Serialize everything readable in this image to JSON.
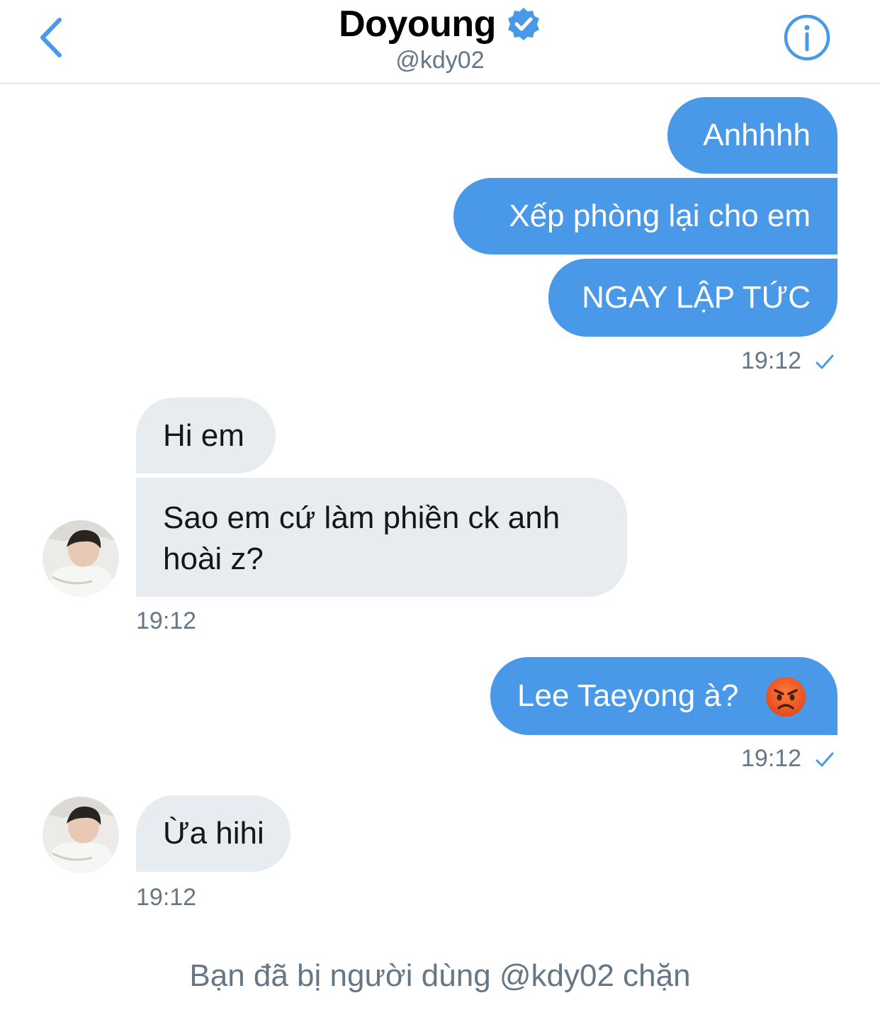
{
  "header": {
    "title": "Doyoung",
    "handle": "@kdy02",
    "verified_color": "#4a99e9",
    "back_icon": "chevron-left-icon",
    "info_icon": "info-icon"
  },
  "messages": [
    {
      "id": "m1",
      "from": "me",
      "text": "Anhhhh"
    },
    {
      "id": "m2",
      "from": "me",
      "text": "Xếp phòng lại cho em"
    },
    {
      "id": "m3",
      "from": "me",
      "text": "NGAY LẬP TỨC"
    },
    {
      "id": "m4",
      "from": "them",
      "text": "Hi em"
    },
    {
      "id": "m5",
      "from": "them",
      "text_line1": "Sao em cứ làm phiền ck anh",
      "text_line2": "hoài z?"
    },
    {
      "id": "m6",
      "from": "me",
      "text": "Lee Taeyong à?",
      "emoji": "😡"
    },
    {
      "id": "m7",
      "from": "them",
      "text": "Ừa hihi"
    }
  ],
  "timestamps": {
    "t1": "19:12",
    "t2": "19:12",
    "t3": "19:12",
    "t4": "19:12"
  },
  "footer": {
    "blocked_text": "Bạn đã bị người dùng @kdy02 chặn"
  },
  "colors": {
    "sent_bubble": "#4a99e9",
    "received_bubble": "#e6ecf0",
    "secondary_text": "#657786"
  }
}
